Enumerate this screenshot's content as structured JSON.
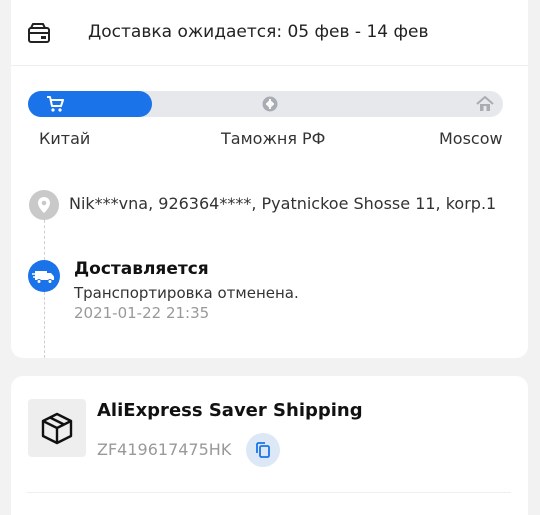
{
  "delivery": {
    "icon": "truck-box-icon",
    "expected_text": "Доставка ожидается: 05 фев - 14 фев"
  },
  "progress": {
    "fraction": 0.26,
    "fill_color": "#1a73e8",
    "steps": [
      {
        "label": "Китай",
        "icon": "cart-icon"
      },
      {
        "label": "Таможня РФ",
        "icon": "customs-icon"
      },
      {
        "label": "Moscow",
        "icon": "home-icon"
      }
    ]
  },
  "address": {
    "icon": "location-pin-icon",
    "text": "Nik***vna,  926364****,  Pyatnickoe Shosse 11, korp.1"
  },
  "status": {
    "icon": "delivery-truck-icon",
    "title": "Доставляется",
    "description": "Транспортировка отменена.",
    "timestamp": "2021-01-22 21:35"
  },
  "shipment": {
    "icon": "package-icon",
    "carrier": "AliExpress Saver Shipping",
    "tracking_number": "ZF419617475HK",
    "copy_icon": "copy-icon"
  },
  "colors": {
    "accent": "#1a73e8",
    "background": "#f2f2f2",
    "muted_text": "#999999"
  }
}
